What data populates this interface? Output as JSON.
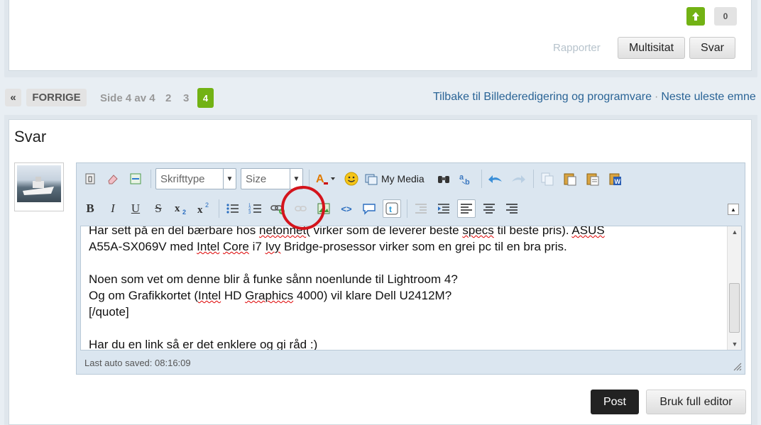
{
  "post": {
    "like_count": "0",
    "report_label": "Rapporter",
    "multiquote_label": "Multisitat",
    "reply_label": "Svar"
  },
  "pagination": {
    "first": "«",
    "prev": "FORRIGE",
    "info": "Side 4 av 4",
    "pages": [
      "2",
      "3"
    ],
    "current": "4"
  },
  "nav": {
    "back_link": "Tilbake til Billederedigering og programvare",
    "separator": "·",
    "next_link": "Neste uleste emne →"
  },
  "reply": {
    "title": "Svar",
    "font_placeholder": "Skrifttype",
    "size_placeholder": "Size",
    "my_media": "My Media",
    "autosave": "Last auto saved: 08:16:09",
    "post_label": "Post",
    "full_editor_label": "Bruk full editor"
  },
  "colors": {
    "accent_green": "#72b214",
    "link_blue": "#2a6496",
    "highlight_red": "#d4141c"
  }
}
